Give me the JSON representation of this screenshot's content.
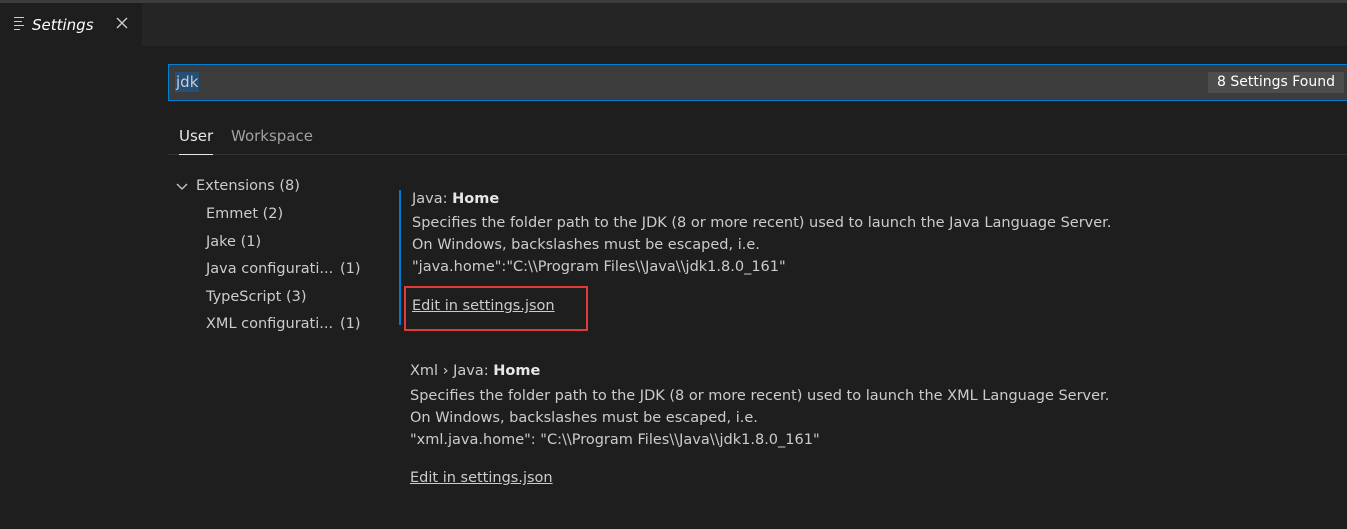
{
  "tab": {
    "title": "Settings",
    "icon": "list-icon",
    "close_icon": "close-icon"
  },
  "search": {
    "value": "jdk",
    "result_count": "8 Settings Found"
  },
  "scope_tabs": [
    {
      "label": "User",
      "active": true
    },
    {
      "label": "Workspace",
      "active": false
    }
  ],
  "toc": {
    "root": {
      "label": "Extensions",
      "count": "(8)"
    },
    "items": [
      {
        "label": "Emmet",
        "count": "(2)"
      },
      {
        "label": "Jake",
        "count": "(1)"
      },
      {
        "label": "Java configurati...",
        "count": "(1)"
      },
      {
        "label": "TypeScript",
        "count": "(3)"
      },
      {
        "label": "XML configurati...",
        "count": "(1)"
      }
    ]
  },
  "settings": [
    {
      "category": "Java: ",
      "name": "Home",
      "description": [
        "Specifies the folder path to the JDK (8 or more recent) used to launch the Java Language Server.",
        "On Windows, backslashes must be escaped, i.e.",
        "\"java.home\":\"C:\\\\Program Files\\\\Java\\\\jdk1.8.0_161\""
      ],
      "link": "Edit in settings.json"
    },
    {
      "category": "Xml › Java: ",
      "name": "Home",
      "description": [
        "Specifies the folder path to the JDK (8 or more recent) used to launch the XML Language Server.",
        "On Windows, backslashes must be escaped, i.e.",
        "\"xml.java.home\": \"C:\\\\Program Files\\\\Java\\\\jdk1.8.0_161\""
      ],
      "link": "Edit in settings.json"
    }
  ],
  "colors": {
    "accent": "#007acc",
    "highlight_box": "#e03c3c"
  }
}
